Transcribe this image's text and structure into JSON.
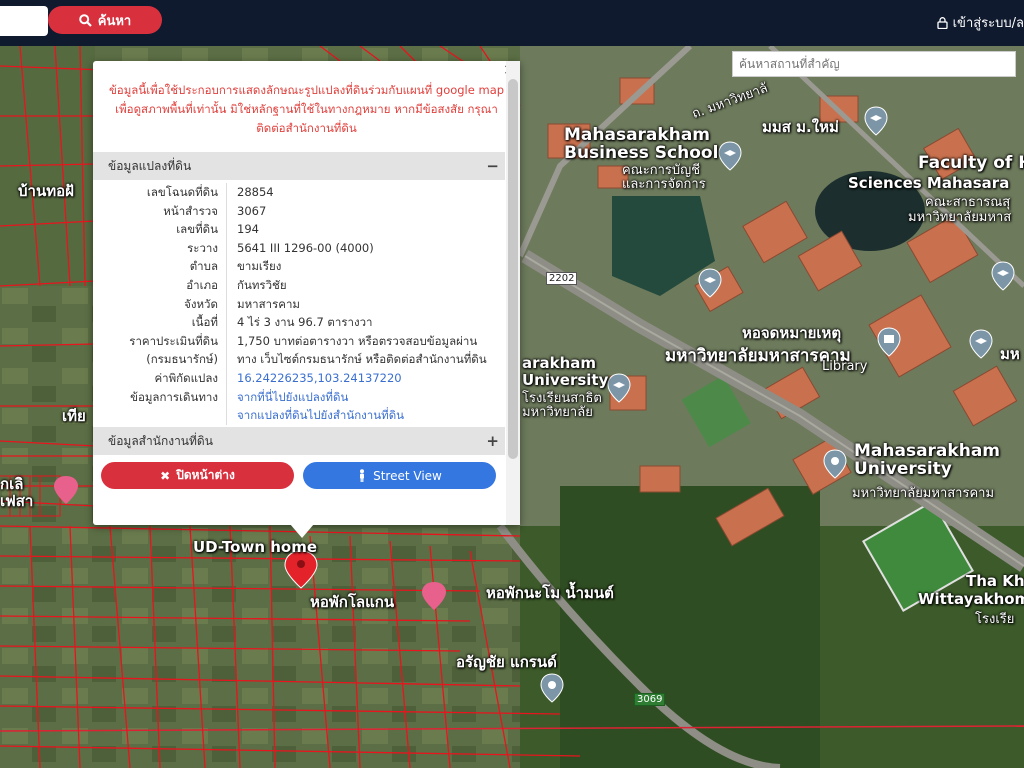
{
  "topbar": {
    "search_label": "ค้นหา",
    "login_label": "เข้าสู่ระบบ/ล"
  },
  "map": {
    "place_search_placeholder": "ค้นหาสถานที่สำคัญ",
    "labels": {
      "business_school": "Mahasarakham\nBusiness School",
      "business_school_th": "คณะการบัญชี\nและการจัดการ",
      "faculty": "Faculty of H",
      "sciences": "Sciences Mahasara",
      "faculty_th": "คณะสาธารณสุ",
      "faculty_th2": "มหาวิทยาลัยมหาส",
      "old_msu": "มมส ม.ใหม่",
      "road_msu": "ถ. มหาวิทยาลั",
      "library_th": "หอจดหมายเหตุ",
      "library_th2": "มหาวิทยาลัยมหาสารคาม",
      "library": "Library",
      "msu_th_right": "มห",
      "msu_left": "arakham\nUniversity",
      "msu_left_th": "โรงเรียนสาธิต\nมหาวิทยาลัย",
      "msu": "Mahasarakham\nUniversity",
      "msu_th": "มหาวิทยาลัยมหาสารคาม",
      "tha_kh": "Tha Kh",
      "wittaya": "Wittayakhom",
      "wittaya_th": "โรงเรีย",
      "ban_thoa": "บ้านทอฝั",
      "thia": "เทีย",
      "ud_town": "UD-Town home",
      "dorm_lokan": "หอพักโลแกน",
      "dorm_nam": "หอพักนะโม น้ำมนต์",
      "arun_chai": "อรัญชัย แกรนด์",
      "left_mid": "กเลิ\nเฟสา"
    },
    "road_badges": {
      "r2202": "2202",
      "r3069": "3069"
    }
  },
  "popup": {
    "close_glyph": "×",
    "disclaimer": [
      "ข้อมูลนี้เพื่อใช้ประกอบการแสดงลักษณะรูปแปลงที่ดินร่วมกับแผนที่ google map",
      "เพื่อดูสภาพพื้นที่เท่านั้น มิใช่หลักฐานที่ใช้ในทางกฎหมาย หากมีข้อสงสัย กรุณา",
      "ติดต่อสำนักงานที่ดิน"
    ],
    "land_section": {
      "title": "ข้อมูลแปลงที่ดิน",
      "toggle": "−"
    },
    "office_section": {
      "title": "ข้อมูลสำนักงานที่ดิน",
      "toggle": "+"
    },
    "rows": [
      {
        "label": "เลขโฉนดที่ดิน",
        "value": "28854"
      },
      {
        "label": "หน้าสำรวจ",
        "value": "3067"
      },
      {
        "label": "เลขที่ดิน",
        "value": "194"
      },
      {
        "label": "ระวาง",
        "value": "5641 III 1296-00 (4000)"
      },
      {
        "label": "ตำบล",
        "value": "ขามเรียง"
      },
      {
        "label": "อำเภอ",
        "value": "กันทรวิชัย"
      },
      {
        "label": "จังหวัด",
        "value": "มหาสารคาม"
      },
      {
        "label": "เนื้อที่",
        "value": "4 ไร่ 3 งาน 96.7 ตารางวา"
      },
      {
        "label": "ราคาประเมินที่ดิน",
        "value": "1,750 บาทต่อตารางวา หรือตรวจสอบข้อมูลผ่าน"
      },
      {
        "label": "(กรมธนารักษ์)",
        "value": "ทาง เว็บไซต์กรมธนารักษ์ หรือติดต่อสำนักงานที่ดิน"
      },
      {
        "label": "ค่าพิกัดแปลง",
        "value": "16.24226235,103.24137220",
        "link": true
      },
      {
        "label": "ข้อมูลการเดินทาง",
        "value": "จากที่นี่ไปยังแปลงที่ดิน",
        "link": true
      },
      {
        "label": "",
        "value": "จากแปลงที่ดินไปยังสำนักงานที่ดิน",
        "link": true
      }
    ],
    "close_button": "ปิดหน้าต่าง",
    "street_view_button": "Street View"
  }
}
